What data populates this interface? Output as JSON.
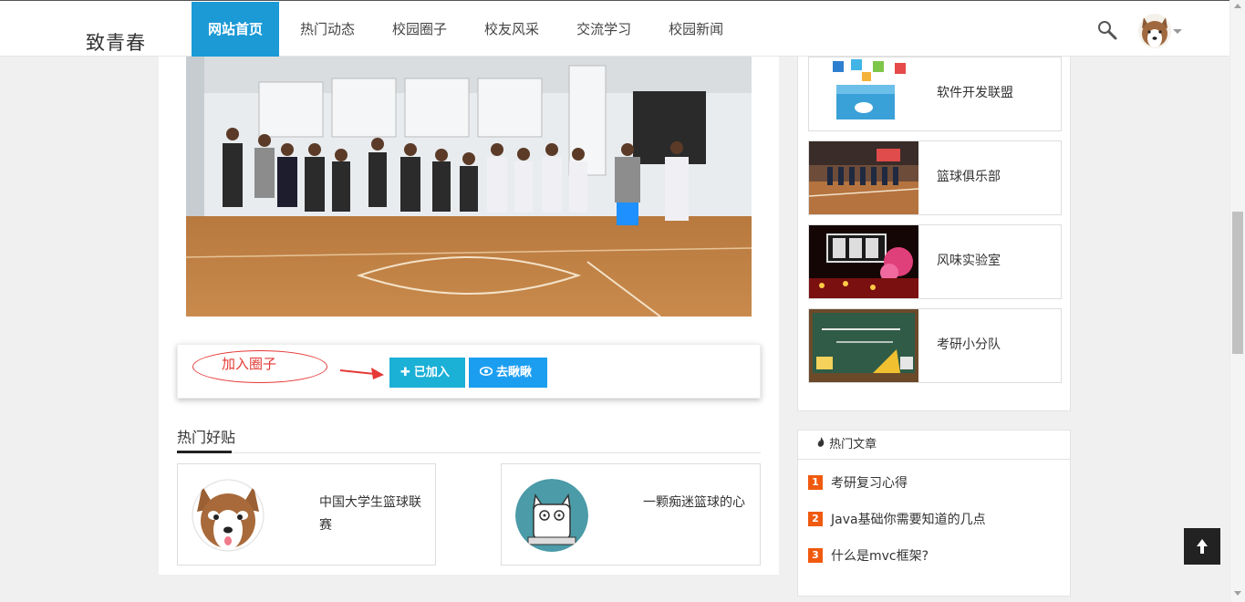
{
  "header": {
    "logo": "致青春",
    "nav": [
      {
        "label": "网站首页",
        "active": true
      },
      {
        "label": "热门动态",
        "active": false
      },
      {
        "label": "校园圈子",
        "active": false
      },
      {
        "label": "校友风采",
        "active": false
      },
      {
        "label": "交流学习",
        "active": false
      },
      {
        "label": "校园新闻",
        "active": false
      }
    ],
    "accent_color": "#1c9ad6"
  },
  "main": {
    "annotation": "加入圈子",
    "buttons": {
      "joined": "已加入",
      "look": "去瞅瞅"
    },
    "hot_posts_title": "热门好贴",
    "posts": [
      {
        "title": "中国大学生篮球联赛",
        "icon": "husky-avatar"
      },
      {
        "title": "一颗痴迷篮球的心",
        "icon": "cat-avatar"
      }
    ]
  },
  "sidebar": {
    "circles": [
      {
        "label": "软件开发联盟"
      },
      {
        "label": "篮球俱乐部"
      },
      {
        "label": "风味实验室"
      },
      {
        "label": "考研小分队"
      }
    ],
    "hot_articles": {
      "title": "热门文章",
      "items": [
        {
          "rank": "1",
          "title": "考研复习心得"
        },
        {
          "rank": "2",
          "title": "Java基础你需要知道的几点"
        },
        {
          "rank": "3",
          "title": "什么是mvc框架?"
        }
      ]
    }
  }
}
